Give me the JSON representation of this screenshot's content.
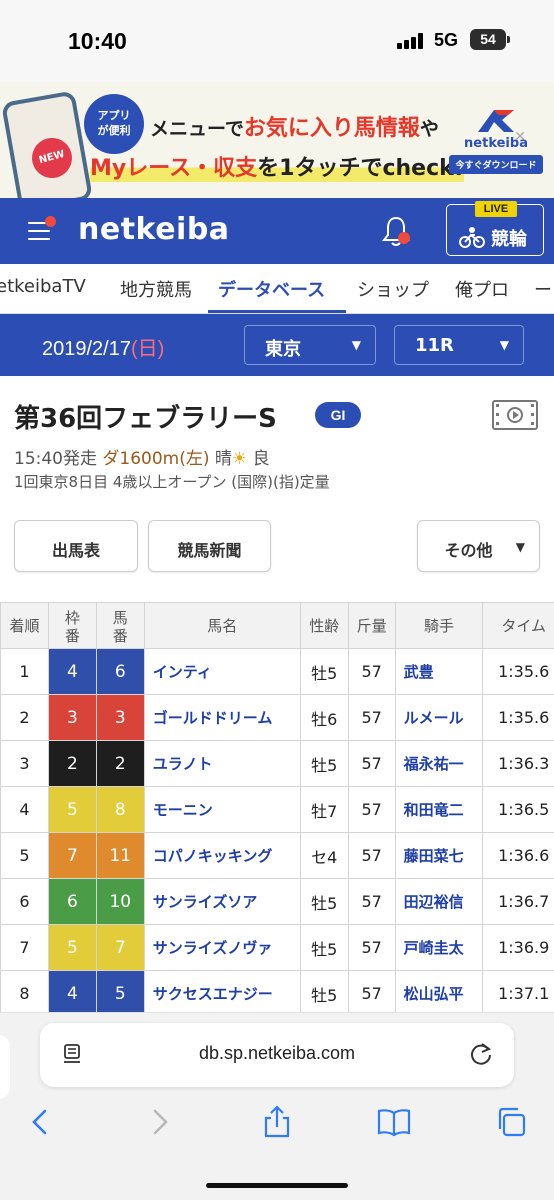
{
  "status": {
    "time": "10:40",
    "network": "5G",
    "battery": "54"
  },
  "ad": {
    "badge": "アプリ\nが便利",
    "new_label": "NEW",
    "line1_pre": "メニューで",
    "line1_hl": "お気に入り馬情報",
    "line1_post": "や",
    "line2_hl": "Myレース・収支",
    "line2_post": "を1タッチでcheck!",
    "logo_text": "netkeiba",
    "download_label": "今すぐダウンロード"
  },
  "header": {
    "logo": "netkeiba",
    "live_label": "LIVE",
    "keirin_label": "競輪"
  },
  "nav": {
    "items": [
      "etkeibaTV",
      "地方競馬",
      "データベース",
      "ショップ",
      "俺プロ",
      "ー"
    ],
    "active": "データベース"
  },
  "datebar": {
    "date": "2019/2/17",
    "weekday": "(日)",
    "venue": "東京",
    "race_no": "11R"
  },
  "race": {
    "title": "第36回フェブラリーS",
    "grade": "GI",
    "start": "15:40発走",
    "distance": "ダ1600m(左)",
    "weather_label": "晴",
    "track_condition": "良",
    "details": "1回東京8日目 4歳以上オープン (国際)(指)定量"
  },
  "buttons": {
    "card": "出馬表",
    "newspaper": "競馬新聞",
    "other": "その他"
  },
  "table": {
    "headers": [
      "着順",
      "枠\n番",
      "馬\n番",
      "馬名",
      "性齢",
      "斤量",
      "騎手",
      "タイム"
    ],
    "rows": [
      {
        "rank": "1",
        "frame": "4",
        "num": "6",
        "horse": "インティ",
        "sexage": "牡5",
        "weight": "57",
        "jockey": "武豊",
        "time": "1:35.6"
      },
      {
        "rank": "2",
        "frame": "3",
        "num": "3",
        "horse": "ゴールドドリーム",
        "sexage": "牡6",
        "weight": "57",
        "jockey": "ルメール",
        "time": "1:35.6"
      },
      {
        "rank": "3",
        "frame": "2",
        "num": "2",
        "horse": "ユラノト",
        "sexage": "牡5",
        "weight": "57",
        "jockey": "福永祐一",
        "time": "1:36.3"
      },
      {
        "rank": "4",
        "frame": "5",
        "num": "8",
        "horse": "モーニン",
        "sexage": "牡7",
        "weight": "57",
        "jockey": "和田竜二",
        "time": "1:36.5"
      },
      {
        "rank": "5",
        "frame": "7",
        "num": "11",
        "horse": "コパノキッキング",
        "sexage": "セ4",
        "weight": "57",
        "jockey": "藤田菜七",
        "time": "1:36.6"
      },
      {
        "rank": "6",
        "frame": "6",
        "num": "10",
        "horse": "サンライズソア",
        "sexage": "牡5",
        "weight": "57",
        "jockey": "田辺裕信",
        "time": "1:36.7"
      },
      {
        "rank": "7",
        "frame": "5",
        "num": "7",
        "horse": "サンライズノヴァ",
        "sexage": "牡5",
        "weight": "57",
        "jockey": "戸崎圭太",
        "time": "1:36.9"
      },
      {
        "rank": "8",
        "frame": "4",
        "num": "5",
        "horse": "サクセスエナジー",
        "sexage": "牡5",
        "weight": "57",
        "jockey": "松山弘平",
        "time": "1:37.1"
      }
    ],
    "frame_colors": {
      "2": "#1e1e1e",
      "3": "#d9443a",
      "4": "#2f4faa",
      "5": "#e2cc3a",
      "6": "#4a9d46",
      "7": "#e08a2e"
    }
  },
  "safari": {
    "url": "db.sp.netkeiba.com"
  },
  "colors": {
    "brand": "#2c4db3",
    "accent_red": "#e5372a"
  }
}
